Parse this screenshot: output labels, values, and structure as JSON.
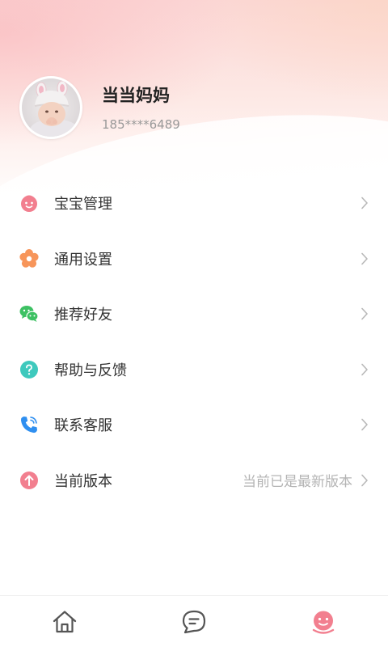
{
  "profile": {
    "name": "当当妈妈",
    "phone": "185****6489",
    "avatar_icon": "baby-photo"
  },
  "menu": {
    "items": [
      {
        "label": "宝宝管理",
        "icon": "baby-face-icon",
        "color": "#f27f8f",
        "value": ""
      },
      {
        "label": "通用设置",
        "icon": "flower-settings-icon",
        "color": "#f7955a",
        "value": ""
      },
      {
        "label": "推荐好友",
        "icon": "wechat-icon",
        "color": "#3dc163",
        "value": ""
      },
      {
        "label": "帮助与反馈",
        "icon": "question-icon",
        "color": "#3ec9bd",
        "value": ""
      },
      {
        "label": "联系客服",
        "icon": "phone-icon",
        "color": "#2f8ff0",
        "value": ""
      },
      {
        "label": "当前版本",
        "icon": "upgrade-arrow-icon",
        "color": "#f27f8f",
        "value": "当前已是最新版本"
      }
    ]
  },
  "tabbar": {
    "tabs": [
      {
        "icon": "home-icon",
        "active": false
      },
      {
        "icon": "chat-icon",
        "active": false
      },
      {
        "icon": "profile-face-icon",
        "active": true
      }
    ],
    "colors": {
      "inactive": "#555555",
      "active": "#f27f8f"
    }
  }
}
